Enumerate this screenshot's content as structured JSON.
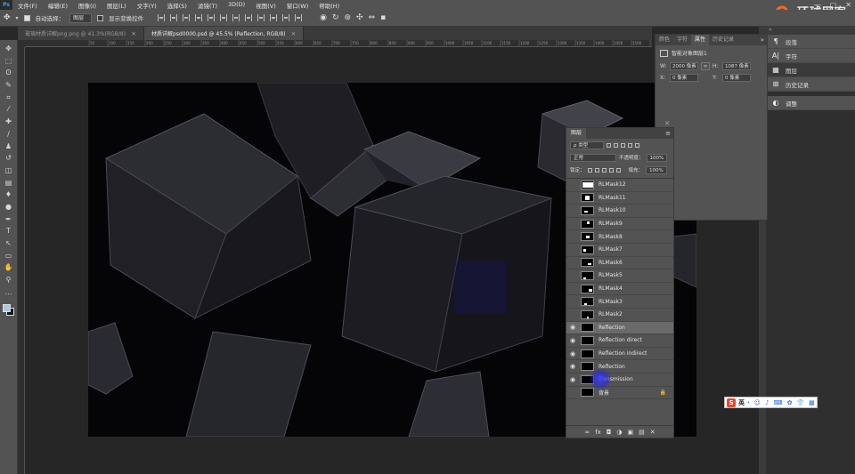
{
  "app": {
    "logo": "Ps",
    "menu": [
      "文件(F)",
      "编辑(E)",
      "图像(I)",
      "图层(L)",
      "文字(Y)",
      "选择(S)",
      "滤镜(T)",
      "3D(D)",
      "视图(V)",
      "窗口(W)",
      "帮助(H)"
    ],
    "window_controls": [
      "—",
      "▢",
      "✕"
    ]
  },
  "watermark": {
    "text": "环球网客",
    "brand_color": "#f26b21"
  },
  "options_bar": {
    "auto_select_label": "自动选择：",
    "auto_select_target": "图层",
    "show_transform_label": "显示变换控件"
  },
  "tabs": [
    {
      "title": "玻璃材质详解png.png @ 41.3%(RGB/8)",
      "active": false
    },
    {
      "title": "材质详解psd0000.psd @ 45.5% (Reflection, RGB/8)",
      "active": true
    }
  ],
  "ruler_ticks": [
    "50",
    "100",
    "150",
    "200",
    "250",
    "300",
    "350",
    "400",
    "450",
    "500",
    "550",
    "600",
    "650",
    "700",
    "750",
    "800",
    "850",
    "900",
    "950",
    "1000",
    "1050",
    "1100",
    "1150",
    "1200",
    "1250",
    "1300",
    "1350",
    "1400",
    "1450",
    "1500",
    "1550"
  ],
  "tools": [
    "move-icon",
    "marquee-icon",
    "lasso-icon",
    "quick-select-icon",
    "crop-icon",
    "eyedropper-icon",
    "healing-icon",
    "brush-icon",
    "stamp-icon",
    "history-brush-icon",
    "eraser-icon",
    "gradient-icon",
    "blur-icon",
    "dodge-icon",
    "pen-icon",
    "type-icon",
    "path-select-icon",
    "shape-icon",
    "hand-icon",
    "zoom-icon",
    "more-icon"
  ],
  "tool_glyphs": [
    "✥",
    "⬚",
    "ʘ",
    "✎",
    "⌗",
    "⁄",
    "✚",
    "∕",
    "♟",
    "↺",
    "◫",
    "▤",
    "♦",
    "●",
    "✒",
    "T",
    "↖",
    "▭",
    "✋",
    "⚲",
    "…"
  ],
  "swatches": {
    "foreground": "#a8c8e8",
    "background": "#111111"
  },
  "right_dock": {
    "items": [
      {
        "icon": "¶",
        "label": "段落"
      },
      {
        "icon": "A|",
        "label": "字符"
      },
      {
        "icon": "▦",
        "label": "图层"
      },
      {
        "icon": "⊞",
        "label": "历史记录"
      },
      {
        "icon": "◐",
        "label": "调整"
      }
    ]
  },
  "properties_panel": {
    "tabs": [
      "颜色",
      "字符",
      "属性",
      "历史记录"
    ],
    "active_tab": "属性",
    "more": "»",
    "title": "智能对象图层1",
    "w_label": "W:",
    "w_value": "2000 像素",
    "h_label": "H:",
    "h_value": "1087 像素",
    "x_label": "X:",
    "x_value": "0 像素",
    "y_label": "Y:",
    "y_value": "0 像素",
    "link_glyph": "∞"
  },
  "layers_panel": {
    "tab": "图层",
    "close": "✕",
    "menu": "≡",
    "filter_kind": "ρ 类型",
    "blend_mode": "正常",
    "opacity_label": "不透明度：",
    "opacity_value": "100%",
    "lock_label": "锁定：",
    "fill_label": "填充：",
    "fill_value": "100%",
    "layers": [
      {
        "name": "RLMask12",
        "visible": false
      },
      {
        "name": "RLMask11",
        "visible": false
      },
      {
        "name": "RLMask10",
        "visible": false
      },
      {
        "name": "RLMask9",
        "visible": false
      },
      {
        "name": "RLMask8",
        "visible": false
      },
      {
        "name": "RLMask7",
        "visible": false
      },
      {
        "name": "RLMask6",
        "visible": false
      },
      {
        "name": "RLMask5",
        "visible": false
      },
      {
        "name": "RLMask4",
        "visible": false
      },
      {
        "name": "RLMask3",
        "visible": false
      },
      {
        "name": "RLMask2",
        "visible": false
      },
      {
        "name": "Reflection",
        "visible": true,
        "selected": true
      },
      {
        "name": "Reflection direct",
        "visible": true
      },
      {
        "name": "Reflection indirect",
        "visible": true
      },
      {
        "name": "Reflection",
        "visible": true
      },
      {
        "name": "Transmission",
        "visible": true
      },
      {
        "name": "背景",
        "visible": false,
        "locked": true
      }
    ],
    "footer_icons": [
      "∞",
      "fx",
      "◘",
      "◑",
      "▣",
      "▤",
      "✕"
    ]
  },
  "ime_bar": {
    "logo": "S",
    "lang": "英",
    "icons": [
      "·",
      "☺",
      "♪",
      "⌨",
      "✿",
      "👕",
      "▦"
    ]
  }
}
